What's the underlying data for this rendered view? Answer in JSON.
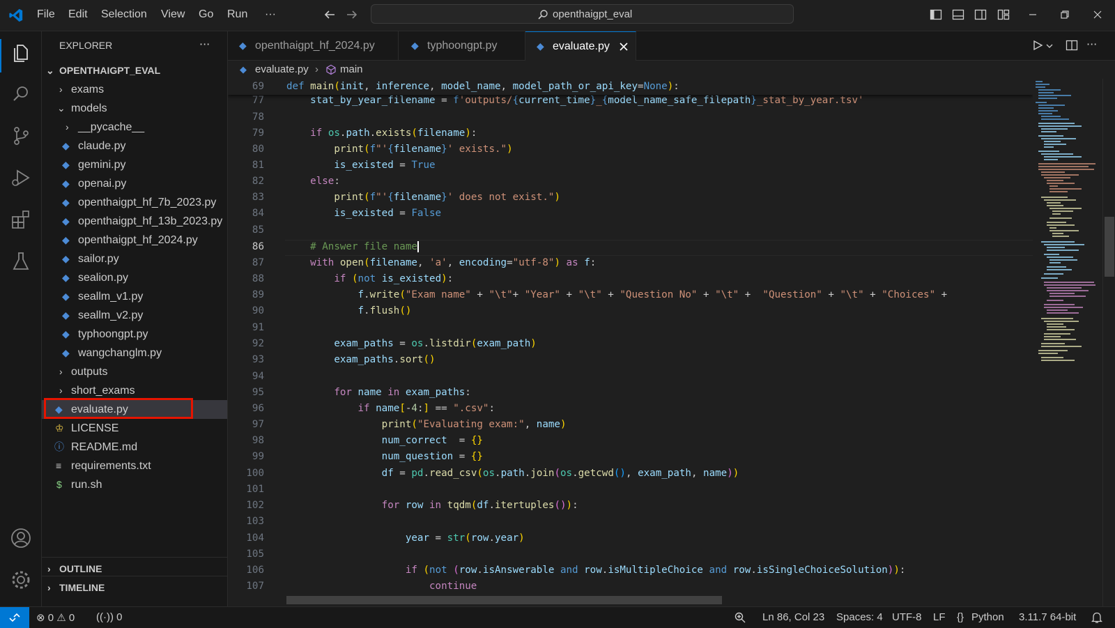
{
  "titlebar": {
    "menus": [
      "File",
      "Edit",
      "Selection",
      "View",
      "Go",
      "Run",
      "···"
    ],
    "search_text": "openthaigpt_eval"
  },
  "sidebar": {
    "title": "EXPLORER",
    "more": "···",
    "root": "OPENTHAIGPT_EVAL",
    "items": [
      {
        "label": "exams",
        "type": "folder",
        "state": "collapsed"
      },
      {
        "label": "models",
        "type": "folder",
        "state": "expanded"
      },
      {
        "label": "__pycache__",
        "type": "folder",
        "state": "collapsed"
      },
      {
        "label": "claude.py",
        "type": "python"
      },
      {
        "label": "gemini.py",
        "type": "python"
      },
      {
        "label": "openai.py",
        "type": "python"
      },
      {
        "label": "openthaigpt_hf_7b_2023.py",
        "type": "python"
      },
      {
        "label": "openthaigpt_hf_13b_2023.py",
        "type": "python"
      },
      {
        "label": "openthaigpt_hf_2024.py",
        "type": "python"
      },
      {
        "label": "sailor.py",
        "type": "python"
      },
      {
        "label": "sealion.py",
        "type": "python"
      },
      {
        "label": "seallm_v1.py",
        "type": "python"
      },
      {
        "label": "seallm_v2.py",
        "type": "python"
      },
      {
        "label": "typhoongpt.py",
        "type": "python"
      },
      {
        "label": "wangchanglm.py",
        "type": "python"
      },
      {
        "label": "outputs",
        "type": "folder",
        "state": "collapsed"
      },
      {
        "label": "short_exams",
        "type": "folder",
        "state": "collapsed"
      },
      {
        "label": "evaluate.py",
        "type": "python",
        "selected": true
      },
      {
        "label": "LICENSE",
        "type": "license"
      },
      {
        "label": "README.md",
        "type": "info"
      },
      {
        "label": "requirements.txt",
        "type": "text"
      },
      {
        "label": "run.sh",
        "type": "shell"
      }
    ],
    "outline": "OUTLINE",
    "timeline": "TIMELINE"
  },
  "tabs": [
    {
      "label": "openthaigpt_hf_2024.py",
      "active": false
    },
    {
      "label": "typhoongpt.py",
      "active": false
    },
    {
      "label": "evaluate.py",
      "active": true
    }
  ],
  "breadcrumb": {
    "file": "evaluate.py",
    "symbol": "main"
  },
  "editor": {
    "current_line": "86",
    "line_numbers": [
      "69",
      "77",
      "78",
      "79",
      "80",
      "81",
      "82",
      "83",
      "84",
      "85",
      "86",
      "87",
      "88",
      "89",
      "90",
      "91",
      "92",
      "93",
      "94",
      "95",
      "96",
      "97",
      "98",
      "99",
      "100",
      "101",
      "102",
      "103",
      "104",
      "105",
      "106",
      "107"
    ]
  },
  "status": {
    "errors": "0",
    "warnings": "0",
    "ports": "0",
    "position": "Ln 86, Col 23",
    "spaces": "Spaces: 4",
    "encoding": "UTF-8",
    "eol": "LF",
    "language": "Python",
    "interpreter": "3.11.7 64-bit"
  },
  "colors": {
    "accent": "#0078d4",
    "selection_outline": "#e51400",
    "python_icon": "#4c8bd6"
  }
}
